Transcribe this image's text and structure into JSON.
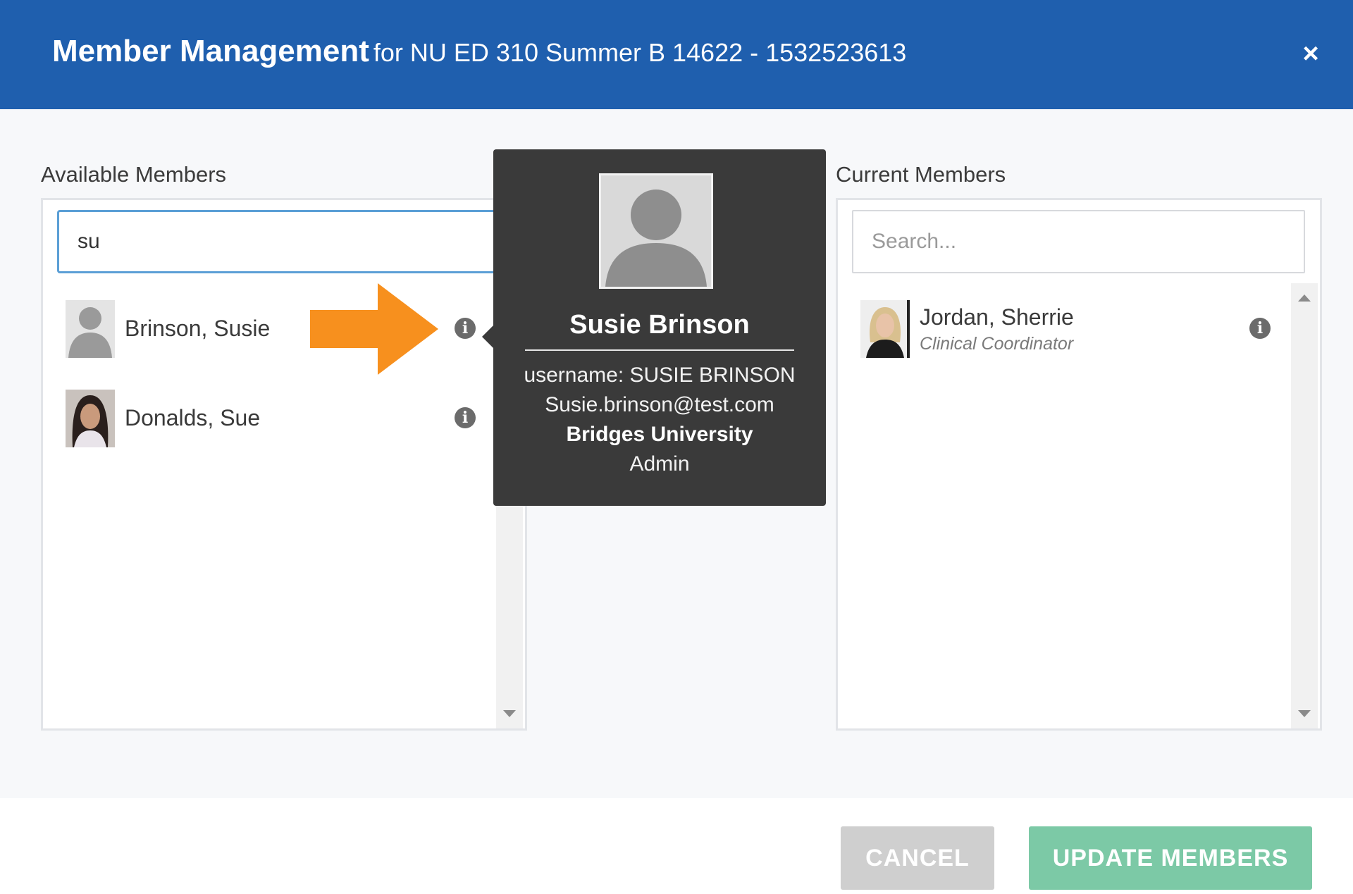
{
  "header": {
    "title": "Member Management",
    "subtitle": "for NU ED 310 Summer B 14622 - 1532523613",
    "close_label": "×"
  },
  "available": {
    "label": "Available Members",
    "search_value": "su",
    "members": [
      {
        "name": "Brinson, Susie"
      },
      {
        "name": "Donalds, Sue"
      }
    ]
  },
  "current": {
    "label": "Current Members",
    "search_placeholder": "Search...",
    "members": [
      {
        "name": "Jordan, Sherrie",
        "role": "Clinical Coordinator"
      }
    ]
  },
  "tooltip": {
    "name": "Susie Brinson",
    "username": "username: SUSIE BRINSON",
    "email": "Susie.brinson@test.com",
    "organization": "Bridges University",
    "role": "Admin"
  },
  "footer": {
    "cancel_label": "CANCEL",
    "update_label": "UPDATE MEMBERS"
  },
  "info_icon_glyph": "i",
  "colors": {
    "header_bg": "#1f5fae",
    "arrow": "#f7901e",
    "update_button": "#7cc9a6",
    "cancel_button": "#cfcfcf",
    "tooltip_bg": "#3a3a3a"
  }
}
